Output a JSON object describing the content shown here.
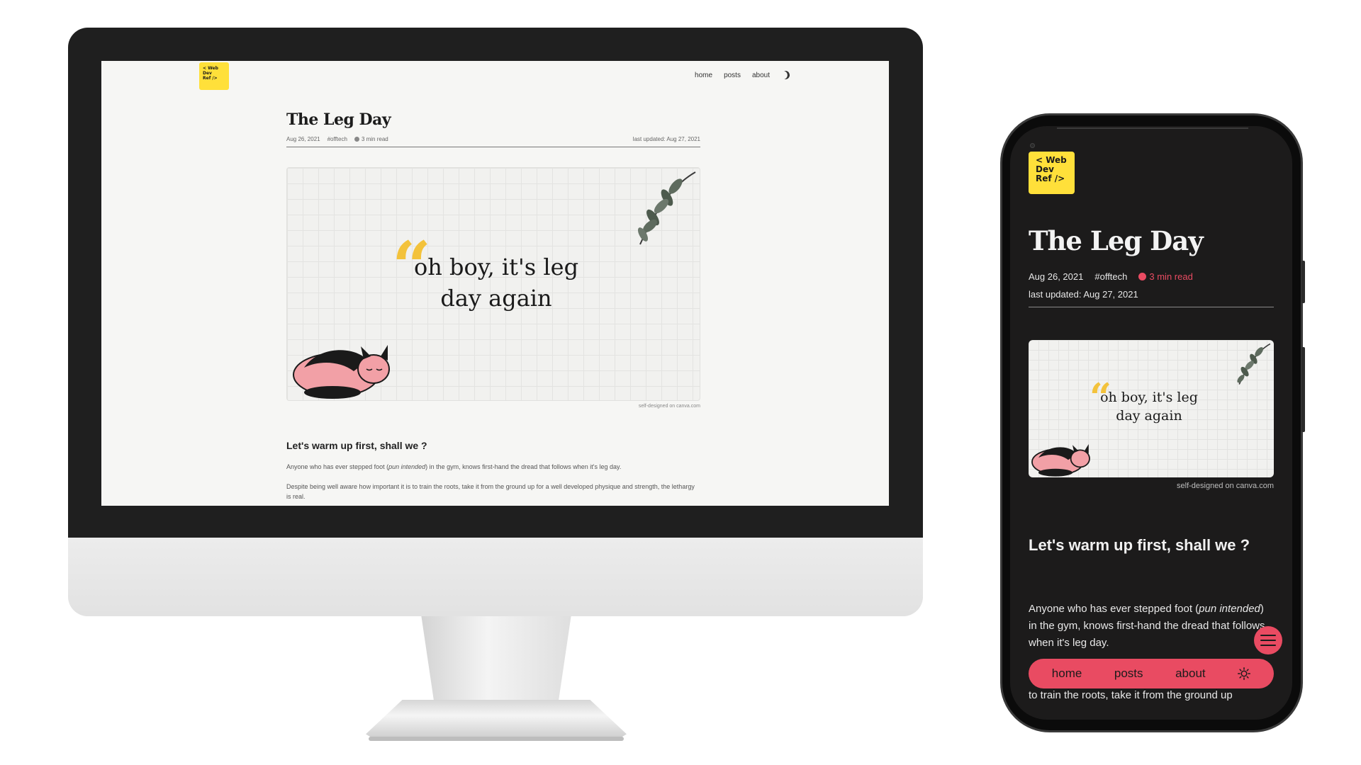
{
  "desktop": {
    "logo": {
      "line1": "< Web",
      "line2": "Dev",
      "line3": "Ref />"
    },
    "nav": {
      "home": "home",
      "posts": "posts",
      "about": "about"
    },
    "post": {
      "title": "The Leg Day",
      "date": "Aug 26, 2021",
      "tag": "#offtech",
      "read_time": "3 min read",
      "updated": "last updated: Aug 27, 2021",
      "hero_quote_line1": "oh boy, it's leg",
      "hero_quote_line2": "day again",
      "hero_caption": "self-designed on canva.com",
      "section_heading": "Let's warm up first, shall we ?",
      "para1_a": "Anyone who has ever stepped foot (",
      "para1_em": "pun intended",
      "para1_b": ") in the gym, knows first-hand the dread that follows when it's leg day.",
      "para2": "Despite being well aware how important it is to train the roots, take it from the ground up for a well developed physique and strength, the lethargy is real."
    }
  },
  "mobile": {
    "logo": {
      "line1": "< Web",
      "line2": "Dev",
      "line3": "Ref />"
    },
    "post": {
      "title": "The Leg Day",
      "date": "Aug 26, 2021",
      "tag": "#offtech",
      "read_time": "3 min read",
      "updated": "last updated: Aug 27, 2021",
      "hero_quote_line1": "oh boy, it's leg",
      "hero_quote_line2": "day again",
      "hero_caption": "self-designed on canva.com",
      "section_heading": "Let's warm up first, shall we ?",
      "para1_a": "Anyone who has ever stepped foot (",
      "para1_em": "pun intended",
      "para1_b": ") in the gym, knows first-hand the dread that follows when it's leg day.",
      "cut_line": "to train the roots, take it from the ground up"
    },
    "nav": {
      "home": "home",
      "posts": "posts",
      "about": "about"
    }
  },
  "colors": {
    "logo_yellow": "#ffe03a",
    "accent_pink": "#e94b62",
    "quote_yellow": "#f3c23b",
    "dark_bg": "#1c1b1b",
    "light_bg": "#f6f6f4"
  },
  "icons": {
    "desktop_theme_toggle": "moon-icon",
    "mobile_theme_toggle": "sun-icon",
    "mobile_menu": "hamburger-menu-icon",
    "read_time": "clock-dot-icon"
  }
}
